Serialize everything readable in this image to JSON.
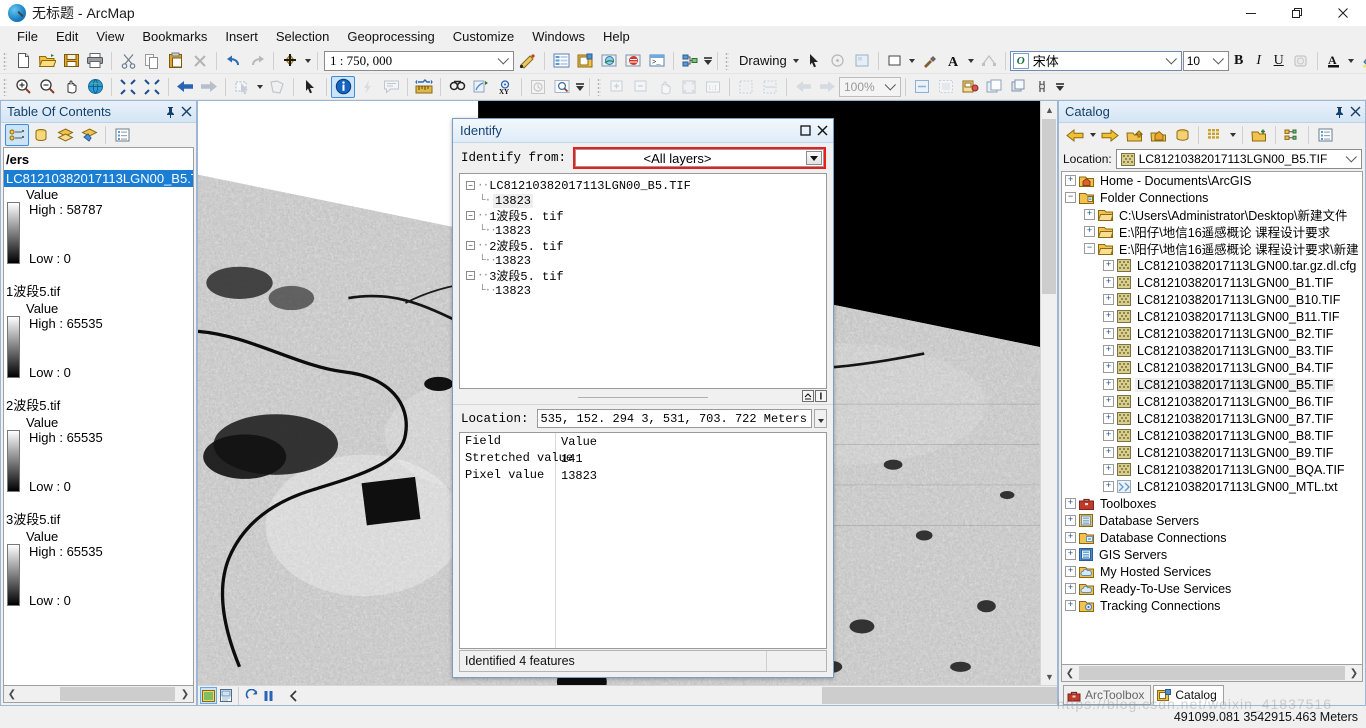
{
  "window": {
    "title_cn": "无标题",
    "title_rest": " - ArcMap",
    "minimize": "—",
    "maximize": "❐",
    "close": "✕"
  },
  "menubar": {
    "items": [
      {
        "label": "File"
      },
      {
        "label": "Edit"
      },
      {
        "label": "View"
      },
      {
        "label": "Bookmarks"
      },
      {
        "label": "Insert"
      },
      {
        "label": "Selection"
      },
      {
        "label": "Geoprocessing"
      },
      {
        "label": "Customize"
      },
      {
        "label": "Windows"
      },
      {
        "label": "Help"
      }
    ]
  },
  "toolbar": {
    "scale_value": "1 : 750, 000",
    "drawing_label": "Drawing",
    "font_name": "宋体",
    "font_size": "10",
    "bold": "B",
    "italic": "I",
    "underline": "U",
    "zoom_percent": "100%"
  },
  "toc": {
    "title": "Table Of Contents",
    "pin": "📌",
    "close": "✕",
    "group_label": "/ers",
    "layers": [
      {
        "name": "LC81210382017113LGN00_B5.TIF",
        "selected": true,
        "value_label": "Value",
        "high": "High : 58787",
        "low": "Low : 0"
      },
      {
        "name": "1波段5.tif",
        "selected": false,
        "value_label": "Value",
        "high": "High : 65535",
        "low": "Low : 0"
      },
      {
        "name": "2波段5.tif",
        "selected": false,
        "value_label": "Value",
        "high": "High : 65535",
        "low": "Low : 0"
      },
      {
        "name": "3波段5.tif",
        "selected": false,
        "value_label": "Value",
        "high": "High : 65535",
        "low": "Low : 0"
      }
    ]
  },
  "identify": {
    "title": "Identify",
    "restore": "❐",
    "close": "✕",
    "from_label": "Identify from:",
    "from_value": "<All layers>",
    "tree": [
      {
        "name": "LC81210382017113LGN00_B5.TIF",
        "value": "13823",
        "highlight": true
      },
      {
        "name": "1波段5. tif",
        "value": "13823",
        "highlight": false
      },
      {
        "name": "2波段5. tif",
        "value": "13823",
        "highlight": false
      },
      {
        "name": "3波段5. tif",
        "value": "13823",
        "highlight": false
      }
    ],
    "location_label": "Location:",
    "location_value": "535, 152. 294    3, 531, 703. 722 Meters",
    "table_headers": {
      "field": "Field",
      "value": "Value"
    },
    "table_rows": [
      {
        "field": "Stretched value",
        "value": "141"
      },
      {
        "field": "Pixel value",
        "value": "13823"
      }
    ],
    "status": "Identified 4 features"
  },
  "catalog": {
    "title": "Catalog",
    "pin": "📌",
    "close": "✕",
    "location_label": "Location:",
    "location_value": "LC81210382017113LGN00_B5.TIF",
    "tree": [
      {
        "label": "Home - Documents\\ArcGIS",
        "indent": 0,
        "expander": "+",
        "icon": "home-folder-icon"
      },
      {
        "label": "Folder Connections",
        "indent": 0,
        "expander": "−",
        "icon": "folder-connections-icon"
      },
      {
        "label": "C:\\Users\\Administrator\\Desktop\\新建文件",
        "indent": 1,
        "expander": "+",
        "icon": "folder-icon"
      },
      {
        "label": "E:\\阳仔\\地信16遥感概论  课程设计要求",
        "indent": 1,
        "expander": "+",
        "icon": "folder-icon"
      },
      {
        "label": "E:\\阳仔\\地信16遥感概论  课程设计要求\\新建",
        "indent": 1,
        "expander": "−",
        "icon": "folder-icon"
      },
      {
        "label": "LC81210382017113LGN00.tar.gz.dl.cfg",
        "indent": 2,
        "expander": "+",
        "icon": "raster-icon"
      },
      {
        "label": "LC81210382017113LGN00_B1.TIF",
        "indent": 2,
        "expander": "+",
        "icon": "raster-icon"
      },
      {
        "label": "LC81210382017113LGN00_B10.TIF",
        "indent": 2,
        "expander": "+",
        "icon": "raster-icon"
      },
      {
        "label": "LC81210382017113LGN00_B11.TIF",
        "indent": 2,
        "expander": "+",
        "icon": "raster-icon"
      },
      {
        "label": "LC81210382017113LGN00_B2.TIF",
        "indent": 2,
        "expander": "+",
        "icon": "raster-icon"
      },
      {
        "label": "LC81210382017113LGN00_B3.TIF",
        "indent": 2,
        "expander": "+",
        "icon": "raster-icon"
      },
      {
        "label": "LC81210382017113LGN00_B4.TIF",
        "indent": 2,
        "expander": "+",
        "icon": "raster-icon"
      },
      {
        "label": "LC81210382017113LGN00_B5.TIF",
        "indent": 2,
        "expander": "+",
        "icon": "raster-icon",
        "selected": true
      },
      {
        "label": "LC81210382017113LGN00_B6.TIF",
        "indent": 2,
        "expander": "+",
        "icon": "raster-icon"
      },
      {
        "label": "LC81210382017113LGN00_B7.TIF",
        "indent": 2,
        "expander": "+",
        "icon": "raster-icon"
      },
      {
        "label": "LC81210382017113LGN00_B8.TIF",
        "indent": 2,
        "expander": "+",
        "icon": "raster-icon"
      },
      {
        "label": "LC81210382017113LGN00_B9.TIF",
        "indent": 2,
        "expander": "+",
        "icon": "raster-icon"
      },
      {
        "label": "LC81210382017113LGN00_BQA.TIF",
        "indent": 2,
        "expander": "+",
        "icon": "raster-icon"
      },
      {
        "label": "LC81210382017113LGN00_MTL.txt",
        "indent": 2,
        "expander": "+",
        "icon": "text-file-icon"
      },
      {
        "label": "Toolboxes",
        "indent": 0,
        "expander": "+",
        "icon": "toolbox-icon"
      },
      {
        "label": "Database Servers",
        "indent": 0,
        "expander": "+",
        "icon": "database-server-icon"
      },
      {
        "label": "Database Connections",
        "indent": 0,
        "expander": "+",
        "icon": "database-connection-icon"
      },
      {
        "label": "GIS Servers",
        "indent": 0,
        "expander": "+",
        "icon": "gis-server-icon"
      },
      {
        "label": "My Hosted Services",
        "indent": 0,
        "expander": "+",
        "icon": "cloud-folder-icon"
      },
      {
        "label": "Ready-To-Use Services",
        "indent": 0,
        "expander": "+",
        "icon": "cloud-folder-icon"
      },
      {
        "label": "Tracking Connections",
        "indent": 0,
        "expander": "+",
        "icon": "tracking-icon"
      }
    ],
    "tabs": [
      {
        "label": "ArcToolbox",
        "active": false
      },
      {
        "label": "Catalog",
        "active": true
      }
    ]
  },
  "statusbar": {
    "coords": "491099.081  3542915.463 Meters",
    "watermark": "https://blog.csdn.net/weixin_41837516"
  },
  "colors": {
    "accent": "#1a7fd4",
    "panel_title": "#14406b",
    "highlight_red": "#ee1c1c",
    "toolbar_bg": "#f0f0f0"
  }
}
